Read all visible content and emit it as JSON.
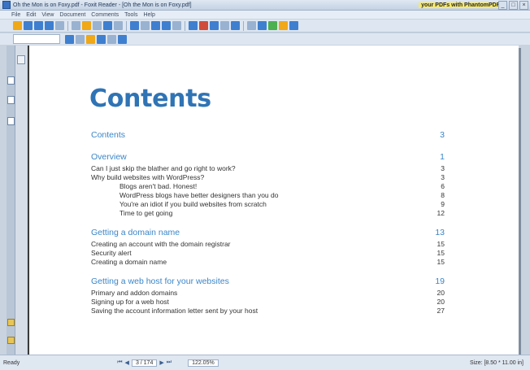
{
  "window": {
    "title": "Oh the Mon is on Foxy.pdf - Foxit Reader - [Oh the Mon is on Foxy.pdf]",
    "ad_text": "your PDFs with PhantomPDF",
    "minimize": "_",
    "maximize": "□",
    "close": "×"
  },
  "menu": [
    "File",
    "Edit",
    "View",
    "Document",
    "Comments",
    "Tools",
    "Help"
  ],
  "toolbar_colors": {
    "row1": [
      "#f0a818",
      "#3f7fd0",
      "#3f7fd0",
      "#3f7fd0",
      "#9ab2d1",
      "#9ab2d1",
      "#f0a818",
      "#9ab2d1",
      "#3f7fd0",
      "#9ab2d1",
      "#3f7fd0",
      "#9ab2d1",
      "#3f7fd0",
      "#3f7fd0",
      "#9ab2d1",
      "#3f7fd0",
      "#d04b3a",
      "#3f7fd0",
      "#9ab2d1",
      "#3f7fd0",
      "#9ab2d1",
      "#3f7fd0",
      "#4caf50",
      "#f0a818",
      "#3f7fd0"
    ],
    "row2": [
      "#3f7fd0",
      "#9ab2d1",
      "#f0a818",
      "#3f7fd0",
      "#9ab2d1",
      "#3f7fd0"
    ]
  },
  "page": {
    "heading": "Contents",
    "toc": [
      {
        "text": "Contents",
        "page": "3",
        "level": "chap",
        "indent": false
      },
      {
        "text": "Overview",
        "page": "1",
        "level": "chap",
        "indent": false
      },
      {
        "text": "Can I just skip the blather and go right to work?",
        "page": "3",
        "level": "1",
        "indent": false
      },
      {
        "text": "Why build websites with WordPress?",
        "page": "3",
        "level": "1",
        "indent": false
      },
      {
        "text": "Blogs aren't bad. Honest!",
        "page": "6",
        "level": "2",
        "indent": true
      },
      {
        "text": "WordPress blogs have better designers than you do",
        "page": "8",
        "level": "2",
        "indent": true
      },
      {
        "text": "You're an idiot if you build websites from scratch",
        "page": "9",
        "level": "2",
        "indent": true
      },
      {
        "text": "Time to get going",
        "page": "12",
        "level": "2",
        "indent": true
      },
      {
        "text": "Getting a domain name",
        "page": "13",
        "level": "chap",
        "indent": false
      },
      {
        "text": "Creating an account with the domain registrar",
        "page": "15",
        "level": "1",
        "indent": false
      },
      {
        "text": "Security alert",
        "page": "15",
        "level": "1",
        "indent": false
      },
      {
        "text": "Creating a domain name",
        "page": "15",
        "level": "1",
        "indent": false
      },
      {
        "text": "Getting a web host for your websites",
        "page": "19",
        "level": "chap",
        "indent": false
      },
      {
        "text": "Primary and addon domains",
        "page": "20",
        "level": "1",
        "indent": false
      },
      {
        "text": "Signing up for a web host",
        "page": "20",
        "level": "1",
        "indent": false
      },
      {
        "text": "Saving the account information letter sent by your host",
        "page": "27",
        "level": "1",
        "indent": false
      }
    ]
  },
  "status": {
    "left": "Ready",
    "first": "⏮",
    "prev": "◀",
    "page_indicator": "3 / 174",
    "next": "▶",
    "last": "⏭",
    "zoom": "122.05%",
    "right": "Size: [8.50 * 11.00 in]"
  }
}
